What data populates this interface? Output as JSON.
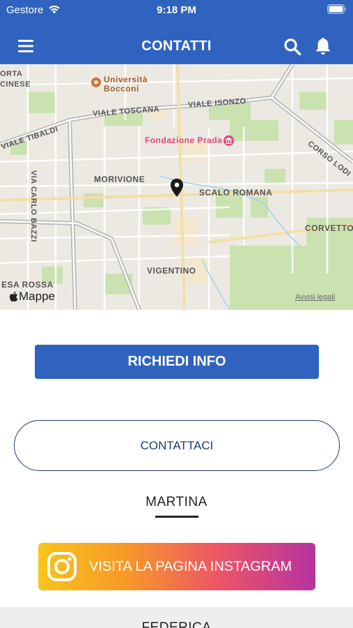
{
  "status_bar": {
    "carrier": "Gestore",
    "time": "9:18 PM"
  },
  "header": {
    "title": "CONTATTI"
  },
  "map": {
    "labels": {
      "porta": "ORTA",
      "cinese": "CINESE",
      "universita": "Università",
      "bocconi": "Bocconi",
      "viale_toscana": "VIALE TOSCANA",
      "viale_isonzo": "VIALE ISONZO",
      "viale_tibaldi": "VIALE TIBALDI",
      "fondazione_prada": "Fondazione Prada",
      "corso_lodi": "CORSO LODI",
      "via_carlo_bazzi": "VIA CARLO BAZZI",
      "morivione": "MORIVIONE",
      "scalo_romana": "SCALO ROMANA",
      "corvetto": "CORVETTO",
      "vigentino": "VIGENTINO",
      "casa_rossa": "ESA ROSSA"
    },
    "logo": "Mappe",
    "legal": "Avvisi legali"
  },
  "actions": {
    "info_button": "RICHIEDI INFO",
    "contact_button": "CONTATTACI"
  },
  "contacts": [
    {
      "name": "MARTINA",
      "instagram_label": "VISITA LA PAGINA INSTAGRAM"
    },
    {
      "name": "FEDERICA"
    }
  ]
}
